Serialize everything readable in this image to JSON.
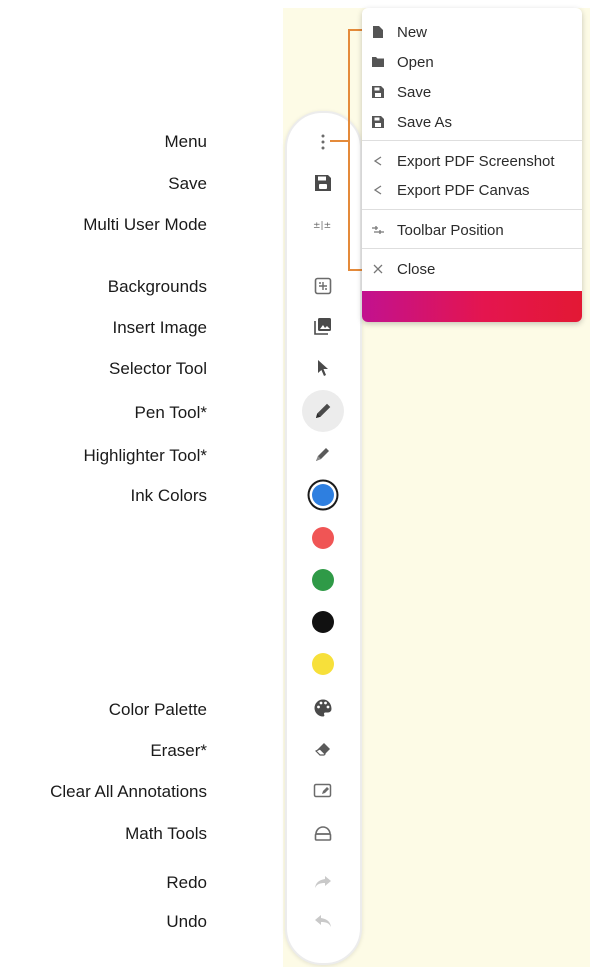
{
  "labels": {
    "menu": "Menu",
    "save": "Save",
    "multi_user_mode": "Multi User Mode",
    "backgrounds": "Backgrounds",
    "insert_image": "Insert Image",
    "selector_tool": "Selector Tool",
    "pen_tool": "Pen Tool*",
    "highlighter_tool": "Highlighter Tool*",
    "ink_colors": "Ink Colors",
    "color_palette": "Color Palette",
    "eraser": "Eraser*",
    "clear_all_annotations": "Clear All Annotations",
    "math_tools": "Math Tools",
    "redo": "Redo",
    "undo": "Undo"
  },
  "menu": {
    "items": [
      {
        "label": "New",
        "icon": "file-icon"
      },
      {
        "label": "Open",
        "icon": "folder-icon"
      },
      {
        "label": "Save",
        "icon": "floppy-icon"
      },
      {
        "label": "Save As",
        "icon": "floppy-icon"
      },
      {
        "label": "Export PDF Screenshot",
        "icon": "share-icon"
      },
      {
        "label": "Export PDF Canvas",
        "icon": "share-icon"
      },
      {
        "label": "Toolbar Position",
        "icon": "toolbar-position-icon"
      },
      {
        "label": "Close",
        "icon": "close-icon"
      }
    ]
  },
  "ink_colors": [
    "#2e7fe0",
    "#f05555",
    "#2f9a47",
    "#111111",
    "#f7e03a"
  ],
  "colors": {
    "canvas": "#fdfbe6",
    "bracket": "#e48a3a",
    "gradient_start": "#c2118f",
    "gradient_end": "#e31834"
  }
}
